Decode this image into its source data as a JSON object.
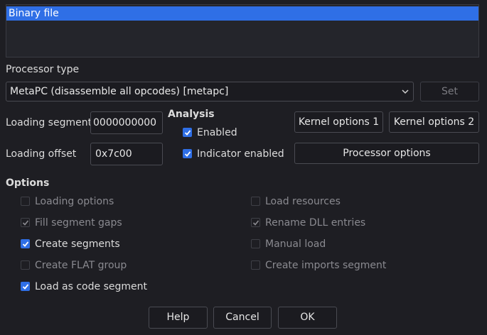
{
  "file_type_list": {
    "items": [
      "Binary file"
    ]
  },
  "processor": {
    "label": "Processor type",
    "selected": "MetaPC (disassemble all opcodes) [metapc]",
    "set_label": "Set"
  },
  "loading": {
    "segment_label": "Loading segment",
    "segment_value": "0000000000",
    "offset_label": "Loading offset",
    "offset_value": "0x7c00"
  },
  "analysis": {
    "title": "Analysis",
    "enabled_label": "Enabled",
    "enabled_checked": true,
    "indicator_label": "Indicator enabled",
    "indicator_checked": true
  },
  "buttons": {
    "kernel1": "Kernel options 1",
    "kernel2": "Kernel options 2",
    "processor_options": "Processor options",
    "help": "Help",
    "cancel": "Cancel",
    "ok": "OK"
  },
  "options": {
    "title": "Options",
    "left": [
      {
        "label": "Loading options",
        "checked": false,
        "enabled": false
      },
      {
        "label": "Fill segment gaps",
        "checked": true,
        "enabled": false
      },
      {
        "label": "Create segments",
        "checked": true,
        "enabled": true
      },
      {
        "label": "Create FLAT group",
        "checked": false,
        "enabled": false
      },
      {
        "label": "Load as code segment",
        "checked": true,
        "enabled": true
      }
    ],
    "right": [
      {
        "label": "Load resources",
        "checked": false,
        "enabled": false
      },
      {
        "label": "Rename DLL entries",
        "checked": true,
        "enabled": false
      },
      {
        "label": "Manual load",
        "checked": false,
        "enabled": false
      },
      {
        "label": "Create imports segment",
        "checked": false,
        "enabled": false
      }
    ]
  }
}
